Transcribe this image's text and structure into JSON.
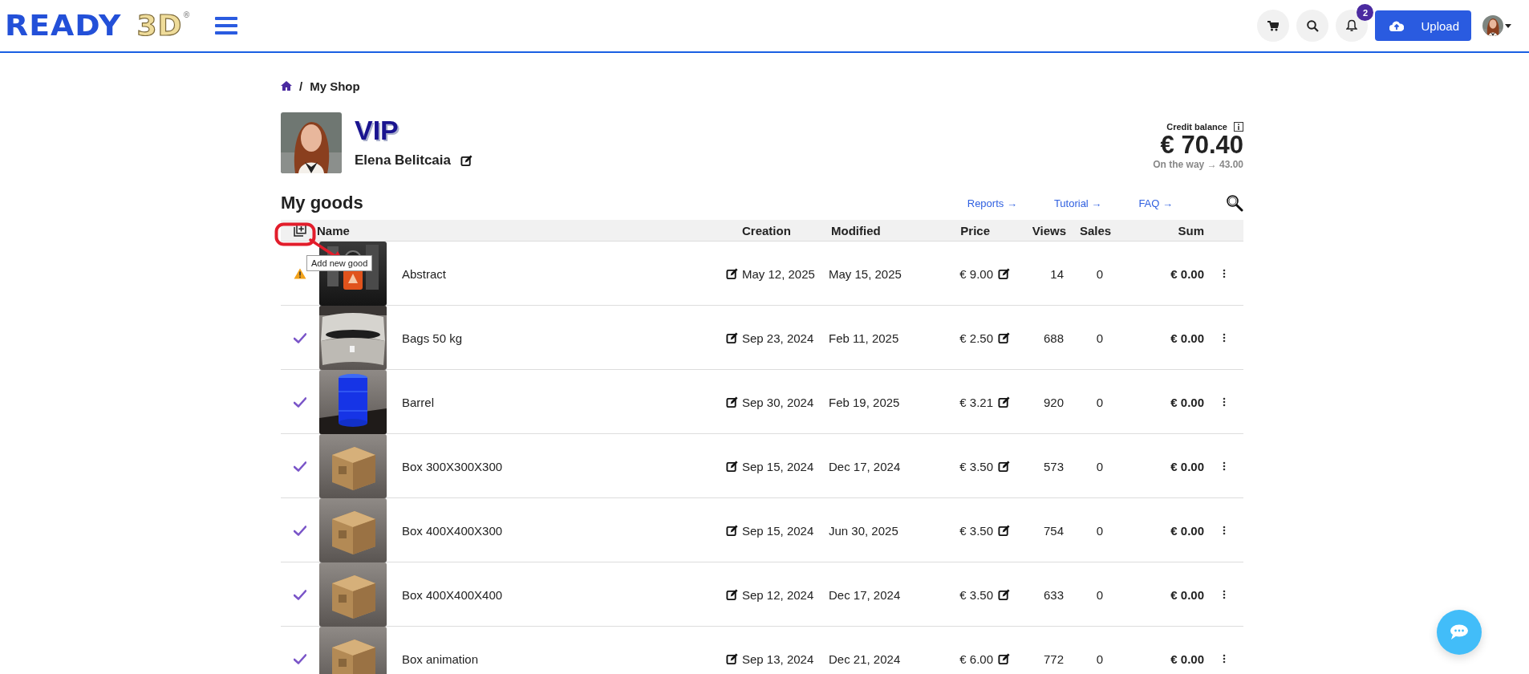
{
  "header": {
    "logo": {
      "word": "READY",
      "mark": "3D",
      "registered": "®"
    },
    "notifications_badge": "2",
    "upload_button": "Upload"
  },
  "breadcrumb": {
    "separator": "/",
    "items": [
      "My Shop"
    ]
  },
  "profile": {
    "tier": "VIP",
    "name": "Elena Belitcaia"
  },
  "balance": {
    "label": "Credit balance",
    "amount": "€ 70.40",
    "on_the_way": "On the way → 43.00"
  },
  "goods": {
    "title": "My goods",
    "links": [
      "Reports →",
      "Tutorial →",
      "FAQ →"
    ],
    "columns": [
      "Name",
      "Creation",
      "Modified",
      "Price",
      "Views",
      "Sales",
      "Sum"
    ],
    "tooltip": "Add new good",
    "rows": [
      {
        "kind": "warning",
        "name": "Abstract",
        "creation": "May 12, 2025",
        "modified": "May 15, 2025",
        "price": "€ 9.00",
        "views": "14",
        "sales": "0",
        "sum": "€ 0.00"
      },
      {
        "kind": "ok",
        "name": "Bags 50 kg",
        "creation": "Sep 23, 2024",
        "modified": "Feb 11, 2025",
        "price": "€ 2.50",
        "views": "688",
        "sales": "0",
        "sum": "€ 0.00"
      },
      {
        "kind": "ok",
        "name": "Barrel",
        "creation": "Sep 30, 2024",
        "modified": "Feb 19, 2025",
        "price": "€ 3.21",
        "views": "920",
        "sales": "0",
        "sum": "€ 0.00"
      },
      {
        "kind": "ok",
        "name": "Box 300X300X300",
        "creation": "Sep 15, 2024",
        "modified": "Dec 17, 2024",
        "price": "€ 3.50",
        "views": "573",
        "sales": "0",
        "sum": "€ 0.00"
      },
      {
        "kind": "ok",
        "name": "Box 400X400X300",
        "creation": "Sep 15, 2024",
        "modified": "Jun 30, 2025",
        "price": "€ 3.50",
        "views": "754",
        "sales": "0",
        "sum": "€ 0.00"
      },
      {
        "kind": "ok",
        "name": "Box 400X400X400",
        "creation": "Sep 12, 2024",
        "modified": "Dec 17, 2024",
        "price": "€ 3.50",
        "views": "633",
        "sales": "0",
        "sum": "€ 0.00"
      },
      {
        "kind": "ok",
        "name": "Box animation",
        "creation": "Sep 13, 2024",
        "modified": "Dec 21, 2024",
        "price": "€ 6.00",
        "views": "772",
        "sales": "0",
        "sum": "€ 0.00"
      }
    ]
  }
}
